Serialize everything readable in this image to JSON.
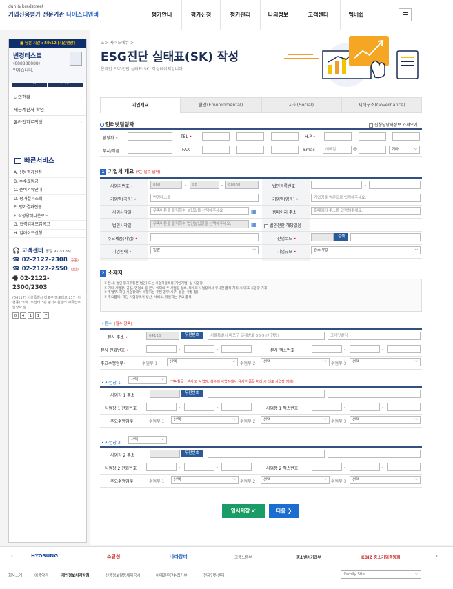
{
  "header": {
    "logo_line1": "dun & bradstreet",
    "logo_line2a": "기업신용평가 전문기관 ",
    "logo_line2b": "나이스디앤비",
    "nav": [
      "평가안내",
      "평가신청",
      "평가관리",
      "나의정보",
      "고객센터",
      "멤버쉽"
    ]
  },
  "sidebar": {
    "session": "■ 남은 시간 : 59:12 [시간연장]",
    "user_name": "변경테스트",
    "user_id": "(888888888)",
    "welcome": "반갑습니다.",
    "logout": "로그아웃",
    "myinfo": "나의정보",
    "menu": [
      "나의현황",
      "세금계산서 확인",
      "온라인자료작성"
    ],
    "quick_title": "빠른서비스",
    "quick": [
      "A. 신용평가신청",
      "B. 수수료입금",
      "C. 준비서류안내",
      "D. 평가결과조회",
      "E. 평가결과전송",
      "F. 작성양식다운로드",
      "G. 협력업체모집공고",
      "H. 업데이트신청"
    ],
    "cc_title": "고객센터",
    "cc_hours": "평일 9시~18시",
    "phones": [
      {
        "num": "02-2122-2308",
        "tag": "(공공)"
      },
      {
        "num": "02-2122-2550",
        "tag": "(민간)"
      },
      {
        "num": "02-2122-2300/2303",
        "tag": ""
      }
    ],
    "addr": "(04117) 서울특별시 마포구 마포대로 217 (아현동) 크레디트센터 3층 평가지원센터 서류접수담당자 앞",
    "zip": [
      "0",
      "4",
      "1",
      "1",
      "7"
    ]
  },
  "main": {
    "breadcrumb": "⌂ > 사이드메뉴 >",
    "title": "ESG진단 실태표(SK) 작성",
    "subtitle": "온라인 ESG진단 실태표(SK) 작성페이지입니다.",
    "tabs": [
      "기업개요",
      "환경(Environmental)",
      "사회(Social)",
      "지배구조(Governance)"
    ],
    "contact": {
      "title": "인터넷담당자",
      "check": "신청담당자정보 가져오기",
      "l_name": "담당자",
      "l_tel": "TEL",
      "l_hp": "H.P",
      "l_dept": "부서/직급",
      "l_fax": "FAX",
      "l_email": "Email",
      "email_ph": "이메일",
      "email_sel": "기타"
    },
    "s1": {
      "title": "기업체 개요",
      "req": "(*는 필수 입력)",
      "l_bizno": "사업자번호",
      "biz1": "888",
      "biz2": "88",
      "biz3": "88888",
      "l_corpno": "법인등록번호",
      "l_namek": "기업명(국문)",
      "namek": "변경테스트",
      "l_namee": "기업명(영문)",
      "namee_ph": "기업명을 영문으로 입력해주세요.",
      "l_bizloc": "사업시작일",
      "bizloc_ph": "우측버튼을 클릭하여 설립일을 선택해주세요",
      "l_home": "홈페이지 주소",
      "home_ph": "홈페이지 주소를 입력해주세요.",
      "l_corpdate": "법인시작일",
      "corpdate_ph": "우측버튼을 클릭하여 법인설립일을 선택해주세요.",
      "conv": "법인전환 해당없음",
      "l_product": "주요제품(사업)",
      "l_ind": "산업코드",
      "ind_btn": "검색",
      "l_form": "기업형태",
      "form_val": "일반",
      "l_scale": "기업규모",
      "scale_val": "중소기업"
    },
    "s2": {
      "title": "소재지",
      "notes": [
        "※ 본사: 법인 등기부등본(법인) 또는 사업자등록증(개인기업) 상 사업장",
        "※ 기타 사업장: 공장, 영업소 등 본사 이외의 주 사업장 정보. 복수의 사업장에서 유사한 품목 처리 시 대표 사업장 기재",
        "※ 주업무: 해당 사업장에서 수행하는 주된 업무(사무, 생산, 유통 등)",
        "※ 주요품목: 해당 사업장에서 생산, 서비스, 유통하는 주요 품목"
      ],
      "hq": "본사",
      "hq_req": "(필수 항목)",
      "l_addr": "본사 주소",
      "zip": "04116",
      "zip_btn": "우편번호",
      "addr1": "서울특별시 마포구 굴레방로 56-9 (아현동)",
      "addr2": "크레딧빌딩",
      "l_tel": "본사 전화번호",
      "l_fax": "본사 팩스번호",
      "l_work": "주요수행업무",
      "w1": "수업무 1",
      "w2": "수업무 2",
      "w3": "수업무 3",
      "sel": "선택",
      "site": "사업장",
      "site1_n": "1",
      "site_note": "(인덕항목 : 본사 외 사업장, 복수의 사업장에서 유사한 품목 처리 시 대표 사업장 기재)",
      "l_s1addr": "사업장 1 주소",
      "l_s1tel": "사업장 1 전화번호",
      "l_s1fax": "사업장 1 팩스번호",
      "site2_n": "2",
      "l_s2addr": "사업장 2 주소",
      "l_s2tel": "사업장 2 전화번호",
      "l_s2fax": "사업장 2 팩스번호"
    },
    "btn_save": "임시저장 ✔",
    "btn_next": "다음 ❯"
  },
  "footer": {
    "partners": [
      "HYOSUNG",
      "조달청",
      "나라장터",
      "고용노동부",
      "중소벤처기업부",
      "KBIZ 중소기업중앙회"
    ],
    "links": [
      "회사소개",
      "이용약관",
      "개인정보처리방침",
      "신용정보활용체제공시",
      "이메일무단수집거부",
      "전자민원센터"
    ],
    "family": "Family Site"
  },
  "colors": {
    "navy": "#1a2c53",
    "blue": "#2a66c7",
    "green": "#1a9c66"
  }
}
